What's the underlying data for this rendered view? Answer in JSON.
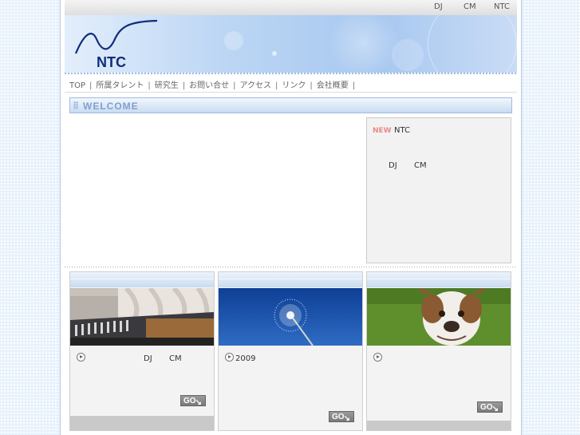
{
  "topbar": {
    "dj": "DJ",
    "cm": "CM",
    "ntc": "NTC"
  },
  "logo": {
    "text": "NTC"
  },
  "nav": {
    "items": [
      {
        "label": "TOP"
      },
      {
        "label": "所属タレント"
      },
      {
        "label": "研究生"
      },
      {
        "label": "お問い合せ"
      },
      {
        "label": "アクセス"
      },
      {
        "label": "リンク"
      },
      {
        "label": "会社概要"
      }
    ],
    "separator": "|"
  },
  "welcome": {
    "title": "WELCOME"
  },
  "news": {
    "new_badge": "NEW",
    "headline": "NTC",
    "dj": "DJ",
    "cm": "CM"
  },
  "cards": [
    {
      "photo": "studio-mixing-console",
      "dj": "DJ",
      "cm": "CM",
      "go": "GO"
    },
    {
      "photo": "dandelion-sky",
      "year": "2009",
      "go": "GO"
    },
    {
      "photo": "bulldog-grass",
      "go": "GO"
    }
  ],
  "colors": {
    "banner": "#a8c8f0",
    "logo": "#102d7c",
    "new_badge": "#e88a8a",
    "welcome": "#7f9fcf"
  }
}
